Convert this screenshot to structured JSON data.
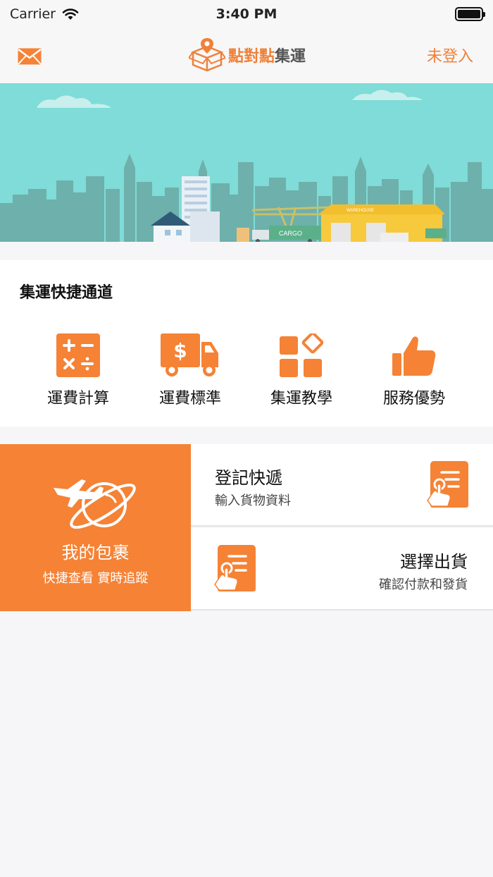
{
  "status_bar": {
    "carrier": "Carrier",
    "time": "3:40 PM"
  },
  "nav": {
    "logo_main": "點對點",
    "logo_sub": "集運",
    "login_label": "未登入"
  },
  "accent_color": "#f58235",
  "banner": {
    "cargo_label": "CARGO",
    "warehouse_label": "WAREHOUSE"
  },
  "shortcuts": {
    "title": "集運快捷通道",
    "items": [
      {
        "label": "運費計算",
        "icon": "calculator-icon"
      },
      {
        "label": "運費標準",
        "icon": "delivery-truck-icon"
      },
      {
        "label": "集運教學",
        "icon": "apps-grid-icon"
      },
      {
        "label": "服務優勢",
        "icon": "thumbs-up-icon"
      }
    ]
  },
  "my_package": {
    "title": "我的包裹",
    "subtitle": "快捷查看 實時追蹤",
    "icon": "airplane-planet-icon"
  },
  "register": {
    "title": "登記快遞",
    "subtitle": "輸入貨物資料",
    "icon": "form-touch-icon"
  },
  "ship": {
    "title": "選擇出貨",
    "subtitle": "確認付款和發貨",
    "icon": "form-touch-icon"
  }
}
